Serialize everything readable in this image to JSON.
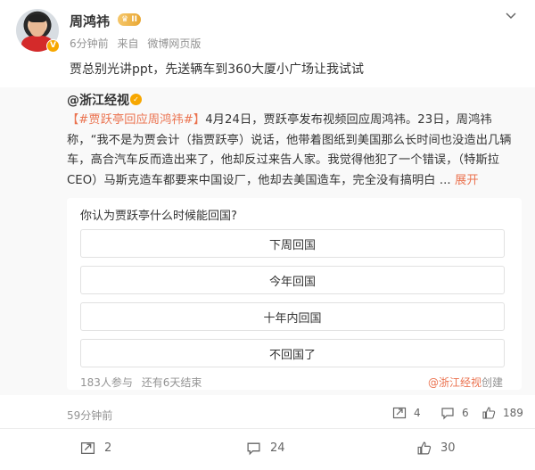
{
  "post": {
    "author": "周鸿祎",
    "level_badge": "II",
    "time": "6分钟前",
    "source_prefix": "来自",
    "source": "微博网页版",
    "text": "贾总别光讲ppt，先送辆车到360大厦小广场让我试试"
  },
  "repost": {
    "author": "@浙江经视",
    "topic": "【#贾跃亭回应周鸿祎#】",
    "body": "4月24日，贾跃亭发布视频回应周鸿祎。23日，周鸿祎称，“我不是为贾会计（指贾跃亭）说话，他带着图纸到美国那么长时间也没造出几辆车，高合汽车反而造出来了，他却反过来告人家。我觉得他犯了一个错误，（特斯拉CEO）马斯克造车都要来中国设厂，他却去美国造车，完全没有搞明白 ...",
    "expand": "展开",
    "poll": {
      "question": "你认为贾跃亭什么时候能回国?",
      "options": [
        "下周回国",
        "今年回国",
        "十年内回国",
        "不回国了"
      ],
      "participants": "183人参与",
      "remaining": "还有6天结束",
      "creator": "@浙江经视",
      "creator_suffix": "创建"
    },
    "time": "59分钟前",
    "stats": {
      "reposts": "4",
      "comments": "6",
      "likes": "189"
    }
  },
  "toolbar": {
    "reposts": "2",
    "comments": "24",
    "likes": "30"
  },
  "colors": {
    "link": "#eb7350",
    "muted": "#939393",
    "badge": "#f7a700"
  }
}
